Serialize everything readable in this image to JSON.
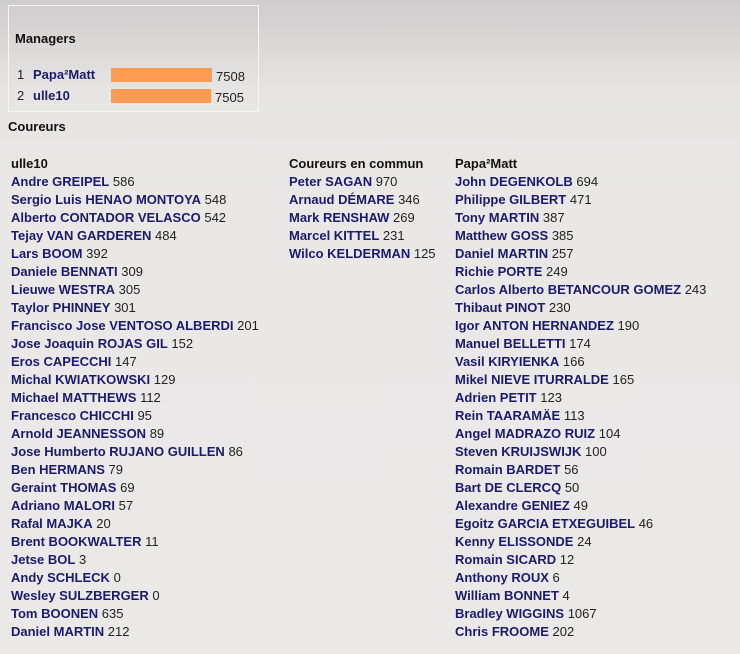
{
  "managers": {
    "title": "Managers",
    "accent_bar_color": "#ff9a52",
    "max_score": 7508,
    "rows": [
      {
        "rank": "1",
        "name": "Papa²Matt",
        "score": "7508",
        "value": 7508
      },
      {
        "rank": "2",
        "name": "ulle10",
        "score": "7505",
        "value": 7505
      }
    ]
  },
  "coureurs": {
    "title": "Coureurs",
    "columns": [
      {
        "header": "ulle10",
        "riders": [
          {
            "name": "Andre GREIPEL",
            "points": "586"
          },
          {
            "name": "Sergio Luis HENAO MONTOYA",
            "points": "548"
          },
          {
            "name": "Alberto CONTADOR VELASCO",
            "points": "542"
          },
          {
            "name": "Tejay VAN GARDEREN",
            "points": "484"
          },
          {
            "name": "Lars BOOM",
            "points": "392"
          },
          {
            "name": "Daniele BENNATI",
            "points": "309"
          },
          {
            "name": "Lieuwe WESTRA",
            "points": "305"
          },
          {
            "name": "Taylor PHINNEY",
            "points": "301"
          },
          {
            "name": "Francisco Jose VENTOSO ALBERDI",
            "points": "201"
          },
          {
            "name": "Jose Joaquin ROJAS GIL",
            "points": "152"
          },
          {
            "name": "Eros CAPECCHI",
            "points": "147"
          },
          {
            "name": "Michal KWIATKOWSKI",
            "points": "129"
          },
          {
            "name": "Michael MATTHEWS",
            "points": "112"
          },
          {
            "name": "Francesco CHICCHI",
            "points": "95"
          },
          {
            "name": "Arnold JEANNESSON",
            "points": "89"
          },
          {
            "name": "Jose Humberto RUJANO GUILLEN",
            "points": "86"
          },
          {
            "name": "Ben HERMANS",
            "points": "79"
          },
          {
            "name": "Geraint THOMAS",
            "points": "69"
          },
          {
            "name": "Adriano MALORI",
            "points": "57"
          },
          {
            "name": "Rafal MAJKA",
            "points": "20"
          },
          {
            "name": "Brent BOOKWALTER",
            "points": "11"
          },
          {
            "name": "Jetse BOL",
            "points": "3"
          },
          {
            "name": "Andy SCHLECK",
            "points": "0"
          },
          {
            "name": "Wesley SULZBERGER",
            "points": "0"
          },
          {
            "name": "Tom BOONEN",
            "points": "635"
          },
          {
            "name": "Daniel MARTIN",
            "points": "212"
          }
        ]
      },
      {
        "header": "Coureurs en commun",
        "riders": [
          {
            "name": "Peter SAGAN",
            "points": "970"
          },
          {
            "name": "Arnaud DÉMARE",
            "points": "346"
          },
          {
            "name": "Mark RENSHAW",
            "points": "269"
          },
          {
            "name": "Marcel KITTEL",
            "points": "231"
          },
          {
            "name": "Wilco KELDERMAN",
            "points": "125"
          }
        ]
      },
      {
        "header": "Papa²Matt",
        "riders": [
          {
            "name": "John DEGENKOLB",
            "points": "694"
          },
          {
            "name": "Philippe GILBERT",
            "points": "471"
          },
          {
            "name": "Tony MARTIN",
            "points": "387"
          },
          {
            "name": "Matthew GOSS",
            "points": "385"
          },
          {
            "name": "Daniel MARTIN",
            "points": "257"
          },
          {
            "name": "Richie PORTE",
            "points": "249"
          },
          {
            "name": "Carlos Alberto BETANCOUR GOMEZ",
            "points": "243"
          },
          {
            "name": "Thibaut PINOT",
            "points": "230"
          },
          {
            "name": "Igor ANTON HERNANDEZ",
            "points": "190"
          },
          {
            "name": "Manuel BELLETTI",
            "points": "174"
          },
          {
            "name": "Vasil KIRYIENKA",
            "points": "166"
          },
          {
            "name": "Mikel NIEVE ITURRALDE",
            "points": "165"
          },
          {
            "name": "Adrien PETIT",
            "points": "123"
          },
          {
            "name": "Rein TAARAMÄE",
            "points": "113"
          },
          {
            "name": "Angel MADRAZO RUIZ",
            "points": "104"
          },
          {
            "name": "Steven KRUIJSWIJK",
            "points": "100"
          },
          {
            "name": "Romain BARDET",
            "points": "56"
          },
          {
            "name": "Bart DE CLERCQ",
            "points": "50"
          },
          {
            "name": "Alexandre GENIEZ",
            "points": "49"
          },
          {
            "name": "Egoitz GARCIA ETXEGUIBEL",
            "points": "46"
          },
          {
            "name": "Kenny ELISSONDE",
            "points": "24"
          },
          {
            "name": "Romain SICARD",
            "points": "12"
          },
          {
            "name": "Anthony ROUX",
            "points": "6"
          },
          {
            "name": "William BONNET",
            "points": "4"
          },
          {
            "name": "Bradley WIGGINS",
            "points": "1067"
          },
          {
            "name": "Chris FROOME",
            "points": "202"
          }
        ]
      }
    ]
  }
}
